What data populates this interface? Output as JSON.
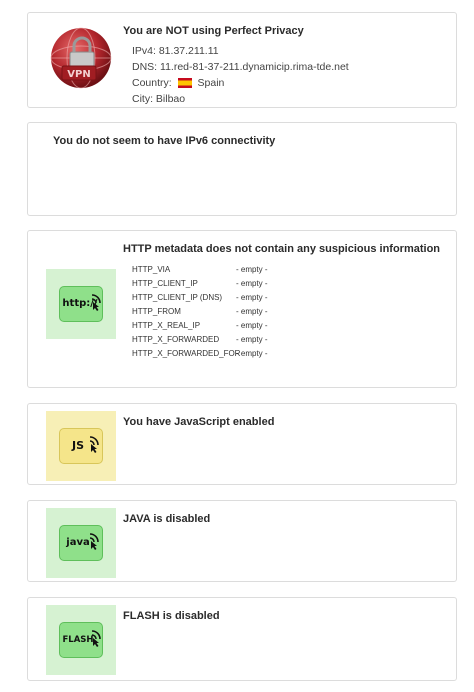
{
  "privacy": {
    "title": "You are NOT using Perfect Privacy",
    "ipv4": "IPv4: 81.37.211.11",
    "dns": "DNS: 11.red-81-37-211.dynamicip.rima-tde.net",
    "country_label": "Country:",
    "country": "Spain",
    "city": "City: Bilbao",
    "logo_text": "VPN"
  },
  "ipv6": {
    "title": "You do not seem to have IPv6 connectivity"
  },
  "http": {
    "title": "HTTP metadata does not contain any suspicious information",
    "icon_label": "http://",
    "rows": [
      {
        "key": "HTTP_VIA",
        "value": "- empty -"
      },
      {
        "key": "HTTP_CLIENT_IP",
        "value": "- empty -"
      },
      {
        "key": "HTTP_CLIENT_IP (DNS)",
        "value": "- empty -"
      },
      {
        "key": "HTTP_FROM",
        "value": "- empty -"
      },
      {
        "key": "HTTP_X_REAL_IP",
        "value": "- empty -"
      },
      {
        "key": "HTTP_X_FORWARDED",
        "value": "- empty -"
      },
      {
        "key": "HTTP_X_FORWARDED_FOR",
        "value": "- empty -"
      }
    ]
  },
  "javascript": {
    "title": "You have JavaScript enabled",
    "icon_label": "JS"
  },
  "java": {
    "title": "JAVA is disabled",
    "icon_label": "java"
  },
  "flash": {
    "title": "FLASH is disabled",
    "icon_label": "FLASH"
  },
  "colors": {
    "ok_tile": "#d6f2d2",
    "ok_inner": "#8fe08a",
    "warn_tile": "#f7efb6",
    "warn_inner": "#f5e58a",
    "danger_red": "#b3262c"
  }
}
